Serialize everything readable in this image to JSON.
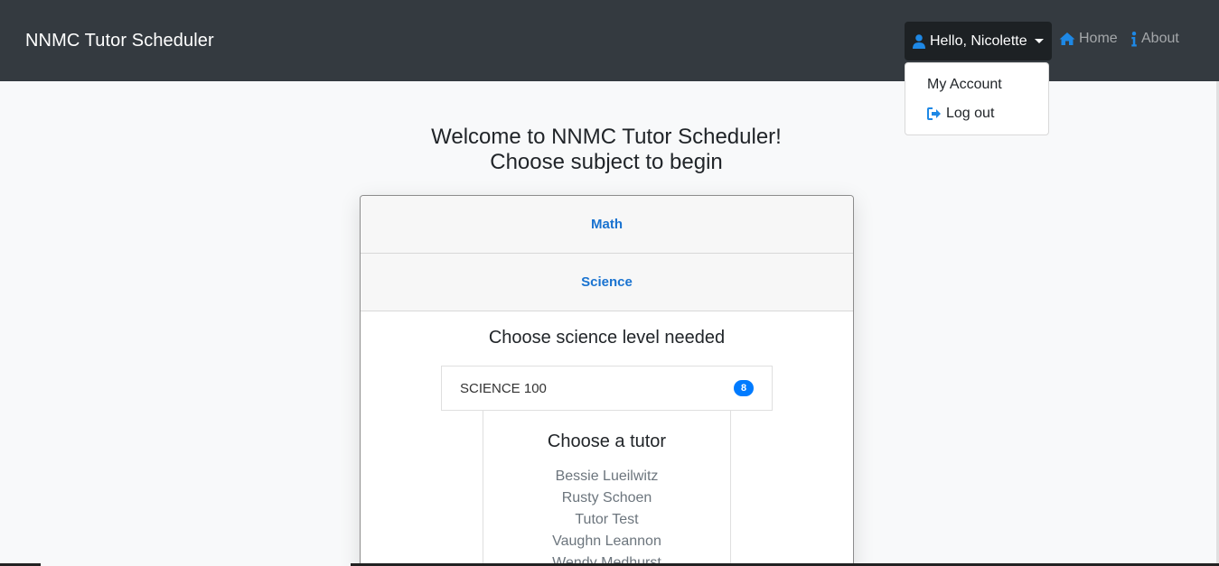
{
  "navbar": {
    "brand": "NNMC Tutor Scheduler",
    "user_greeting": "Hello, Nicolette",
    "home_label": "Home",
    "about_label": "About",
    "bg_color": "#343a40"
  },
  "user_menu": {
    "items": [
      {
        "label": "My Account"
      },
      {
        "label": "Log out"
      }
    ]
  },
  "main": {
    "welcome_line1": "Welcome to NNMC Tutor Scheduler!",
    "welcome_line2": "Choose subject to begin",
    "subjects": [
      {
        "label": "Math"
      },
      {
        "label": "Science"
      }
    ],
    "level_heading": "Choose science level needed",
    "levels": [
      {
        "label": "SCIENCE 100",
        "count": "8"
      }
    ],
    "tutor_heading": "Choose a tutor",
    "tutors": [
      "Bessie Lueilwitz",
      "Rusty Schoen",
      "Tutor Test",
      "Vaughn Leannon",
      "Wendy Medhurst"
    ]
  },
  "colors": {
    "accent": "#007bff",
    "link": "#1a73d0"
  }
}
